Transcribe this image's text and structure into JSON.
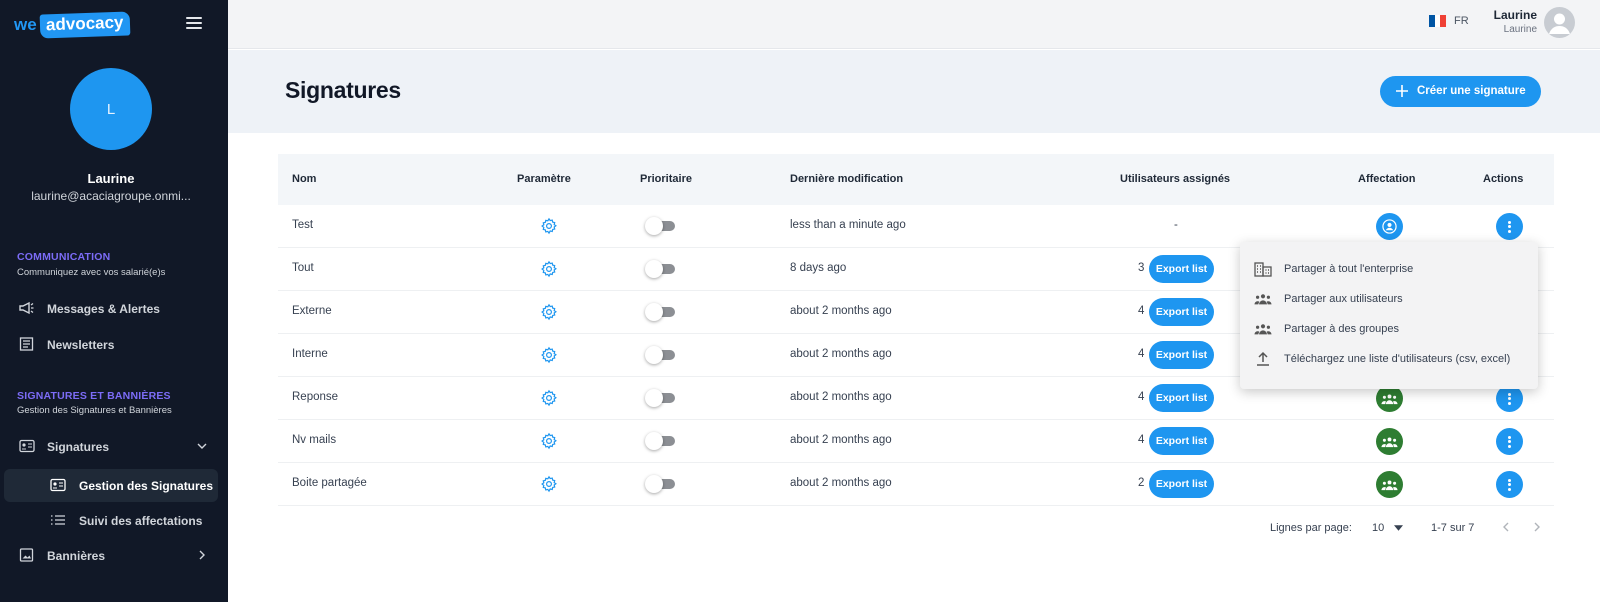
{
  "brand": {
    "we": "we",
    "advocacy": "advocacy"
  },
  "sidebar": {
    "avatar_initial": "L",
    "user_name": "Laurine",
    "user_email": "laurine@acaciagroupe.onmi...",
    "sections": [
      {
        "title": "COMMUNICATION",
        "subtitle": "Communiquez avec vos salarié(e)s"
      },
      {
        "title": "SIGNATURES ET BANNIÈRES",
        "subtitle": "Gestion des Signatures et Bannières"
      }
    ],
    "items": [
      {
        "label": "Messages & Alertes",
        "icon": "megaphone-icon"
      },
      {
        "label": "Newsletters",
        "icon": "newspaper-icon"
      },
      {
        "label": "Signatures",
        "icon": "id-card-icon"
      },
      {
        "label": "Gestion des Signatures",
        "icon": "id-card-icon"
      },
      {
        "label": "Suivi des affectations",
        "icon": "list-icon"
      },
      {
        "label": "Bannières",
        "icon": "image-icon"
      }
    ]
  },
  "topbar": {
    "lang": "FR",
    "user_name": "Laurine",
    "user_sub": "Laurine",
    "flag_colors": [
      "#0055a4",
      "#ffffff",
      "#ef4135"
    ]
  },
  "page": {
    "title": "Signatures",
    "create_label": "Créer une signature"
  },
  "table": {
    "headers": {
      "nom": "Nom",
      "parametre": "Paramètre",
      "prioritaire": "Prioritaire",
      "derniere": "Dernière modification",
      "utilisateurs": "Utilisateurs assignés",
      "affectation": "Affectation",
      "actions": "Actions"
    },
    "export_label": "Export list",
    "rows": [
      {
        "nom": "Test",
        "modif": "less than a minute ago",
        "users": "-",
        "affectation": "user"
      },
      {
        "nom": "Tout",
        "modif": "8 days ago",
        "users": "3",
        "affectation": "company"
      },
      {
        "nom": "Externe",
        "modif": "about 2 months ago",
        "users": "4",
        "affectation": "group"
      },
      {
        "nom": "Interne",
        "modif": "about 2 months ago",
        "users": "4",
        "affectation": "group"
      },
      {
        "nom": "Reponse",
        "modif": "about 2 months ago",
        "users": "4",
        "affectation": "group"
      },
      {
        "nom": "Nv mails",
        "modif": "about 2 months ago",
        "users": "4",
        "affectation": "group"
      },
      {
        "nom": "Boite partagée",
        "modif": "about 2 months ago",
        "users": "2",
        "affectation": "group"
      }
    ]
  },
  "menu": {
    "items": [
      {
        "label": "Partager à tout l'enterprise",
        "icon": "building-icon"
      },
      {
        "label": "Partager aux utilisateurs",
        "icon": "users-icon"
      },
      {
        "label": "Partager à des groupes",
        "icon": "groups-icon"
      },
      {
        "label": "Téléchargez une liste d'utilisateurs (csv, excel)",
        "icon": "upload-icon"
      }
    ]
  },
  "pagination": {
    "rows_label": "Lignes par page:",
    "rows_value": "10",
    "range": "1-7 sur 7"
  },
  "colors": {
    "accent": "#1e96f0",
    "sidebar_bg": "#111827",
    "section_title": "#7c6cf7",
    "group_green": "#2e7d32"
  }
}
